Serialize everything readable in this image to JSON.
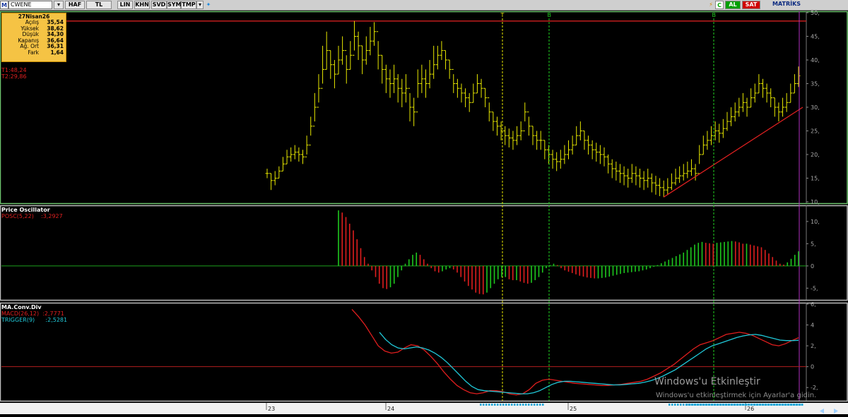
{
  "toolbar": {
    "symbol": "CWENE",
    "buttons": [
      "HAF",
      "TL",
      "LIN",
      "KHN",
      "SVD",
      "SYM",
      "TMP"
    ],
    "logo_letter": "M",
    "al_label": "AL",
    "sat_label": "SAT",
    "brand": "MATRİKS"
  },
  "info_box": {
    "date": "27Nisan26",
    "rows": [
      {
        "label": "Açılış",
        "value": "35,54"
      },
      {
        "label": "Yüksek",
        "value": "38,62"
      },
      {
        "label": "Düşük",
        "value": "34,30"
      },
      {
        "label": "Kapanış",
        "value": "36,64"
      },
      {
        "label": "Ağ. Ort",
        "value": "36,31"
      },
      {
        "label": "Fark",
        "value": "1,64"
      }
    ]
  },
  "trend_labels": {
    "t1": "T1:48,24",
    "t2": "T2:29,86"
  },
  "signals": [
    "T",
    "B",
    "B"
  ],
  "colors": {
    "price": "#e8e800",
    "up": "#1ec81e",
    "down": "#e01e1e",
    "macd": "#e01e1e",
    "trigger": "#20c8d8",
    "border_green": "#6cc26c"
  },
  "chart_data": [
    {
      "type": "ohlc",
      "title": "",
      "y_ticks": [
        "50,",
        "45,",
        "40,",
        "35,",
        "30,",
        "25,",
        "20,",
        "15,",
        "10,"
      ],
      "ylim": [
        10,
        50
      ],
      "resistance_level": 48.24,
      "x_ticks": [
        "23",
        "24",
        "25",
        "26"
      ],
      "close": [
        16,
        14.5,
        15,
        16.5,
        18,
        19.5,
        20,
        20.5,
        20,
        19.5,
        22,
        26,
        30,
        34,
        38,
        42,
        39,
        37,
        40,
        42,
        38,
        41,
        45,
        43,
        40,
        42,
        44,
        46,
        41,
        38,
        36,
        35,
        36,
        34,
        33,
        34,
        30,
        29,
        35,
        36,
        35,
        37,
        39,
        41,
        42,
        40,
        38,
        35,
        34,
        33,
        32,
        31,
        33,
        35,
        34,
        32,
        29,
        27,
        26,
        25,
        24,
        23.5,
        23,
        24,
        25,
        29,
        26,
        24,
        23,
        23,
        21,
        20,
        19,
        18.5,
        19,
        20,
        21,
        22,
        24,
        25,
        23,
        22,
        21,
        20.5,
        20,
        19.5,
        18,
        17,
        16.5,
        16,
        15.5,
        15,
        16,
        15.5,
        15,
        14.5,
        15,
        14,
        13.5,
        13,
        12.5,
        13,
        14,
        15,
        15.5,
        16,
        16.5,
        17,
        16,
        20,
        22,
        23,
        24,
        25,
        24.5,
        25.5,
        27,
        28,
        29,
        30,
        31,
        30,
        32,
        33,
        35,
        34,
        33,
        32,
        30,
        29,
        30,
        31,
        33,
        35,
        36.64
      ],
      "high": [
        17,
        16,
        16.5,
        17.5,
        19.5,
        21,
        21.5,
        22,
        21.5,
        21,
        24,
        28,
        33,
        37,
        43,
        46,
        42,
        40,
        43,
        45,
        41,
        44,
        48.24,
        46,
        43,
        45,
        47,
        48,
        44,
        41,
        39,
        38,
        39,
        37,
        36,
        37,
        33,
        32,
        38,
        39,
        38,
        40,
        43,
        43,
        44,
        42,
        40,
        37,
        36,
        35,
        34,
        33,
        35,
        37,
        36,
        34,
        31,
        29,
        28,
        27,
        26,
        25.5,
        25,
        26,
        27,
        31,
        28,
        26,
        25,
        25,
        23,
        22,
        21,
        20.5,
        21,
        22,
        23,
        24,
        26,
        27,
        25,
        24,
        23,
        22.5,
        22,
        21.5,
        20,
        19,
        18.5,
        18,
        17.5,
        17,
        18,
        17.5,
        17,
        16.5,
        17,
        16,
        15.5,
        15,
        14.5,
        15,
        16,
        17,
        17.5,
        18,
        18.5,
        19,
        18,
        22,
        24,
        25,
        26,
        27,
        26.5,
        27.5,
        29,
        30,
        31,
        32,
        33,
        32,
        34,
        35,
        37,
        36,
        35,
        34,
        32,
        31,
        32,
        33,
        35,
        37,
        38.62
      ],
      "low": [
        15,
        12.5,
        13.5,
        15,
        16.5,
        18,
        18.5,
        19,
        18.5,
        18,
        20,
        24,
        27,
        31,
        35,
        38,
        36,
        34,
        37,
        39,
        35,
        38,
        42,
        40,
        37,
        39,
        41,
        43,
        38,
        35,
        33,
        32,
        33,
        31,
        30,
        31,
        27,
        26,
        32,
        33,
        32,
        34,
        36,
        38,
        40,
        38,
        36,
        33,
        32,
        31,
        30,
        29,
        31,
        33,
        32,
        30,
        27,
        25,
        24,
        23,
        22,
        21.5,
        21,
        22,
        23,
        27,
        24,
        22,
        21,
        21,
        19,
        18,
        17,
        16.5,
        17,
        18,
        19,
        20,
        22,
        23,
        21,
        20,
        19,
        18.5,
        18,
        17.5,
        16,
        15,
        14.5,
        14,
        13.5,
        13,
        14,
        13.5,
        13,
        12.5,
        13,
        12,
        11.5,
        11.2,
        11,
        11.5,
        12.5,
        13.5,
        14,
        14.5,
        15,
        15.5,
        14.5,
        18,
        20,
        21,
        22,
        23,
        22.5,
        23.5,
        25,
        26,
        27,
        28,
        29,
        28,
        30,
        31,
        33,
        32,
        31,
        30,
        28,
        27,
        28,
        29,
        31,
        33,
        34.3
      ]
    },
    {
      "type": "bar",
      "title": "Price Oscillator",
      "series": [
        {
          "name": "POSC(5,22)",
          "last": "3,2927"
        }
      ],
      "y_ticks": [
        "10,",
        "5,",
        "0",
        "-5,"
      ],
      "ylim": [
        -7,
        13
      ],
      "values": [
        12.5,
        12,
        11,
        9.5,
        8,
        6,
        4,
        2,
        0.5,
        -1,
        -2.5,
        -4,
        -5,
        -5.2,
        -4.8,
        -4,
        -2.5,
        -1,
        0.5,
        1.5,
        2.5,
        3,
        2.5,
        1.5,
        0.5,
        -0.5,
        -1.2,
        -1.5,
        -1.2,
        -0.8,
        -0.5,
        -0.8,
        -1.5,
        -2.5,
        -3.5,
        -4.5,
        -5.3,
        -6,
        -6.3,
        -6.4,
        -6,
        -5,
        -4,
        -3,
        -2.5,
        -2.5,
        -3,
        -3.2,
        -3.2,
        -3.5,
        -3.8,
        -4,
        -3.8,
        -3.2,
        -2.5,
        -1.5,
        -0.5,
        0.2,
        0.5,
        0.2,
        -0.5,
        -1,
        -1.3,
        -1.6,
        -1.9,
        -2.2,
        -2.4,
        -2.6,
        -2.7,
        -2.8,
        -2.8,
        -2.7,
        -2.6,
        -2.4,
        -2.2,
        -2,
        -1.8,
        -1.6,
        -1.5,
        -1.4,
        -1.3,
        -1.2,
        -1,
        -0.8,
        -0.5,
        -0.2,
        0.2,
        0.6,
        1,
        1.4,
        1.8,
        2.2,
        2.6,
        3,
        3.6,
        4.2,
        4.8,
        5.2,
        5.4,
        5.2,
        5.1,
        5,
        5.2,
        5.3,
        5.4,
        5.5,
        5.6,
        5.5,
        5.3,
        5,
        5,
        4.8,
        4.6,
        4.4,
        4.2,
        3.6,
        2.8,
        2,
        1.2,
        0.5,
        0.3,
        0.8,
        1.6,
        2.5,
        3.29
      ]
    },
    {
      "type": "line",
      "title": "MA.Conv.Div",
      "series": [
        {
          "name": "MACD(26,12)",
          "last": "2,7771",
          "values": [
            5.5,
            4.8,
            4,
            3,
            2,
            1.5,
            1.3,
            1.4,
            1.8,
            2.1,
            2,
            1.6,
            1,
            0.3,
            -0.5,
            -1.2,
            -1.8,
            -2.2,
            -2.5,
            -2.6,
            -2.5,
            -2.3,
            -2.3,
            -2.4,
            -2.6,
            -2.7,
            -2.6,
            -2.2,
            -1.6,
            -1.3,
            -1.2,
            -1.3,
            -1.4,
            -1.5,
            -1.6,
            -1.65,
            -1.7,
            -1.75,
            -1.8,
            -1.8,
            -1.75,
            -1.7,
            -1.6,
            -1.5,
            -1.4,
            -1.2,
            -0.9,
            -0.6,
            -0.2,
            0.2,
            0.7,
            1.2,
            1.7,
            2.1,
            2.3,
            2.5,
            2.8,
            3.1,
            3.2,
            3.3,
            3.2,
            3,
            2.7,
            2.4,
            2.1,
            2,
            2.2,
            2.5,
            2.78
          ]
        },
        {
          "name": "TRIGGER(9)",
          "last": "2,5281",
          "values": [
            3.3,
            2.6,
            2.1,
            1.8,
            1.7,
            1.8,
            1.9,
            1.8,
            1.6,
            1.3,
            0.9,
            0.4,
            -0.2,
            -0.8,
            -1.4,
            -1.9,
            -2.2,
            -2.3,
            -2.35,
            -2.4,
            -2.45,
            -2.5,
            -2.55,
            -2.6,
            -2.6,
            -2.5,
            -2.3,
            -2,
            -1.7,
            -1.5,
            -1.4,
            -1.4,
            -1.45,
            -1.5,
            -1.55,
            -1.6,
            -1.65,
            -1.7,
            -1.75,
            -1.75,
            -1.7,
            -1.65,
            -1.6,
            -1.5,
            -1.35,
            -1.15,
            -0.9,
            -0.6,
            -0.3,
            0.1,
            0.5,
            0.9,
            1.3,
            1.7,
            2,
            2.2,
            2.4,
            2.6,
            2.8,
            2.95,
            3.05,
            3.1,
            3,
            2.85,
            2.7,
            2.55,
            2.5,
            2.5,
            2.53
          ]
        }
      ],
      "y_ticks": [
        "6,",
        "4",
        "2,",
        "0",
        "-2,"
      ],
      "ylim": [
        -3,
        6
      ]
    }
  ],
  "watermark": {
    "title": "Windows'u Etkinleştir",
    "subtitle": "Windows'u etkinleştirmek için Ayarlar'a gidin."
  }
}
